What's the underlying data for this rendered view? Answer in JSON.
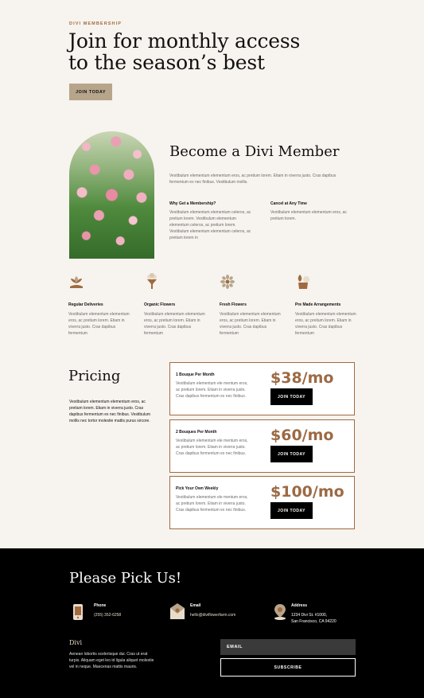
{
  "hero": {
    "eyebrow": "DIVI MEMBERSHIP",
    "title_line1": "Join for monthly access",
    "title_line2": "to the season’s best",
    "cta": "JOIN TODAY"
  },
  "member": {
    "title": "Become a Divi Member",
    "desc": "Vestibulum elementum elementum eros, ac pretium lorem. Etiam in viverra justo. Cras dapibus fermentum ex nec finibus. Vestibulum mollis.",
    "blocks": [
      {
        "title": "Why Get a Membership?",
        "text": "Vestibulum elementum elementum celeros, ac pretium lorem. Vestibulum elementum elementum celeros, ac pretium lorem. Vestibulum elementum elementum celeros, ac pretium lorem in"
      },
      {
        "title": "Cancel at Any Time",
        "text": "Vestibulum elementum elementum eros, ac pretium lorem."
      }
    ]
  },
  "features": [
    {
      "title": "Regular Deliveries",
      "text": "Vestibulum elementum elementum eros, ac pretium lorem. Etiam in viverra justo. Cras dapibus fermentum",
      "icon": "plant-icon"
    },
    {
      "title": "Organic Flowers",
      "text": "Vestibulum elementum elementum eros, ac pretium lorem. Etiam in viverra justo. Cras dapibus fermentum",
      "icon": "bouquet-icon"
    },
    {
      "title": "Fresh Flowers",
      "text": "Vestibulum elementum elementum eros, ac pretium lorem. Etiam in viverra justo. Cras dapibus fermentum",
      "icon": "flower-icon"
    },
    {
      "title": "Pre Made Arrangements",
      "text": "Vestibulum elementum elementum eros, ac pretium lorem. Etiam in viverra justo. Cras dapibus fermentum",
      "icon": "vase-icon"
    }
  ],
  "pricing": {
    "title": "Pricing",
    "desc": "Vestibulum elementum elementum eros, ac pretium lorem. Etiam in viverra justo. Cras dapibus fermentum ex nec finibus. Vestibulum mollis nec tortor molestie mattis purus sircore.",
    "plans": [
      {
        "name": "1 Bouque Per Month",
        "text": "Vestibulum elementum ele mentum eros, ac pretium lorem. Etiam in viverra justo. Cras dapibus fermentum ex nec finibus.",
        "price": "$38/mo",
        "cta": "JOIN TODAY"
      },
      {
        "name": "2 Bouques Per Month",
        "text": "Vestibulum elementum ele mentum eros, ac pretium lorem. Etiam in viverra justo. Cras dapibus fermentum ex nec finibus.",
        "price": "$60/mo",
        "cta": "JOIN TODAY"
      },
      {
        "name": "Pick Your Own Weekly",
        "text": "Vestibulum elementum ele mentum eros, ac pretium lorem. Etiam in viverra justo. Cras dapibus fermentum ex nec finibus.",
        "price": "$100/mo",
        "cta": "JOIN TODAY"
      }
    ]
  },
  "footer": {
    "title": "Please Pick Us!",
    "contacts": [
      {
        "label": "Phone",
        "value": "(255) 352-6258",
        "value2": "",
        "icon": "phone-icon"
      },
      {
        "label": "Email",
        "value": "hello@diviflowerfarm.com",
        "value2": "",
        "icon": "envelope-icon"
      },
      {
        "label": "Address",
        "value": "1234 Divi St. #1000,",
        "value2": "San Francisco, CA 94220",
        "icon": "map-pin-icon"
      }
    ],
    "brand": "Divi",
    "brand_text": "Aenean lobortis scelerisque dui. Cras ut erat turpis. Aliquam eget leo id ligula aliquet molestie vel in neque. Maecenas mattis mauris.",
    "email_placeholder": "EMAIL",
    "subscribe": "SUBSCRIBE"
  },
  "colors": {
    "accent": "#a06b3f",
    "button_tan": "#b7a58b",
    "background": "#f7f3ee"
  }
}
